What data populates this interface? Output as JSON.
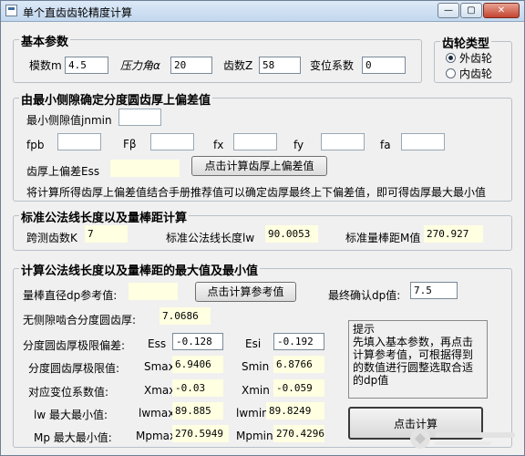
{
  "window": {
    "title": "单个直齿齿轮精度计算"
  },
  "basic": {
    "title": "基本参数",
    "module_label": "模数m",
    "module_value": "4.5",
    "angle_label": "压力角α",
    "angle_value": "20",
    "teeth_label": "齿数Z",
    "teeth_value": "58",
    "shift_label": "变位系数",
    "shift_value": "0"
  },
  "gear_type": {
    "title": "齿轮类型",
    "external": "外齿轮",
    "internal": "内齿轮"
  },
  "upper": {
    "title": "由最小侧隙确定分度圆齿厚上偏差值",
    "jnmin_label": "最小侧隙值jnmin",
    "jnmin_value": "",
    "fpb_label": "fpb",
    "fpb_value": "",
    "fbeta_label": "Fβ",
    "fbeta_value": "",
    "fx_label": "fx",
    "fx_value": "",
    "fy_label": "fy",
    "fy_value": "",
    "fa_label": "fa",
    "fa_value": "",
    "ess_label": "齿厚上偏差Ess",
    "ess_value": "",
    "calc_button": "点击计算齿厚上偏差值",
    "note": "将计算所得齿厚上偏差值结合手册推荐值可以确定齿厚最终上下偏差值，即可得齿厚最大最小值"
  },
  "standard": {
    "title": "标准公法线长度以及量棒距计算",
    "k_label": "跨测齿数K",
    "k_value": "7",
    "lw_label": "标准公法线长度lw",
    "lw_value": "90.0053",
    "m_label": "标准量棒距M值",
    "m_value": "270.927"
  },
  "calc": {
    "title": "计算公法线长度以及量棒距的最大值及最小值",
    "dp_ref_label": "量棒直径dp参考值:",
    "dp_ref_value": "",
    "ref_button": "点击计算参考值",
    "dp_final_label": "最终确认dp值:",
    "dp_final_value": "7.5",
    "pitch_label": "无侧隙啮合分度圆齿厚:",
    "pitch_value": "7.0686",
    "limit_dev_label": "分度圆齿厚极限偏差:",
    "ess_name": "Ess",
    "ess_value": "-0.128",
    "esi_name": "Esi",
    "esi_value": "-0.192",
    "thick_label": "分度圆齿厚极限值:",
    "smax_name": "Smax",
    "smax_value": "6.9406",
    "smin_name": "Smin",
    "smin_value": "6.8766",
    "shift_label": "对应变位系数值:",
    "xmax_name": "Xmax",
    "xmax_value": "-0.03",
    "xmin_name": "Xmin",
    "xmin_value": "-0.059",
    "lw_label": "lw 最大最小值:",
    "lwmax_name": "lwmax",
    "lwmax_value": "89.885",
    "lwmin_name": "lwmin",
    "lwmin_value": "89.8249",
    "mp_label": "Mp 最大最小值:",
    "mpmax_name": "Mpmax",
    "mpmax_value": "270.5949",
    "mpmin_name": "Mpmin",
    "mpmin_value": "270.4296",
    "hint": "提示\n先填入基本参数，再点击计算参考值，可根据得到的数值进行圆整选取合适的dp值",
    "calc_button": "点击计算"
  },
  "colors": {
    "output_bg": "#ffffe1",
    "window_bg": "#f0f0f0",
    "close_red": "#c4442f"
  }
}
